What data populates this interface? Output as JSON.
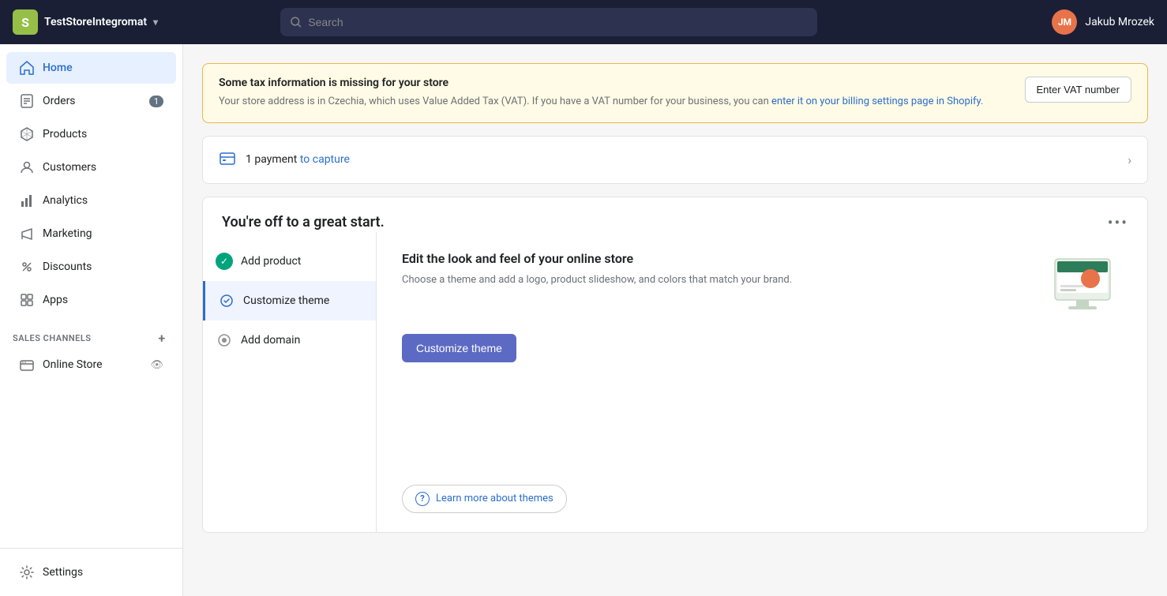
{
  "topnav": {
    "store_name": "TestStoreIntegromat",
    "search_placeholder": "Search",
    "user_initials": "JM",
    "user_name": "Jakub Mrozek"
  },
  "sidebar": {
    "nav_items": [
      {
        "id": "home",
        "label": "Home",
        "icon": "home",
        "active": true
      },
      {
        "id": "orders",
        "label": "Orders",
        "icon": "orders",
        "badge": "1"
      },
      {
        "id": "products",
        "label": "Products",
        "icon": "products"
      },
      {
        "id": "customers",
        "label": "Customers",
        "icon": "customers"
      },
      {
        "id": "analytics",
        "label": "Analytics",
        "icon": "analytics"
      },
      {
        "id": "marketing",
        "label": "Marketing",
        "icon": "marketing"
      },
      {
        "id": "discounts",
        "label": "Discounts",
        "icon": "discounts"
      },
      {
        "id": "apps",
        "label": "Apps",
        "icon": "apps"
      }
    ],
    "sales_channels_label": "SALES CHANNELS",
    "online_store_label": "Online Store",
    "settings_label": "Settings"
  },
  "tax_banner": {
    "title": "Some tax information is missing for your store",
    "body_text": "Your store address is in Czechia, which uses Value Added Tax (VAT). If you have a VAT number for your business, you can enter it on your billing settings page in Shopify.",
    "cta_label": "Enter VAT number"
  },
  "payment_capture": {
    "text": "1 payment",
    "link_text": "to capture"
  },
  "getting_started": {
    "title": "You're off to a great start.",
    "dots": "•••",
    "steps": [
      {
        "id": "add-product",
        "label": "Add product",
        "status": "done"
      },
      {
        "id": "customize-theme",
        "label": "Customize theme",
        "status": "active"
      },
      {
        "id": "add-domain",
        "label": "Add domain",
        "status": "pending"
      }
    ],
    "content": {
      "title": "Edit the look and feel of your online store",
      "description": "Choose a theme and add a logo, product slideshow, and colors that match your brand.",
      "cta_label": "Customize theme",
      "learn_more_label": "Learn more about themes"
    }
  }
}
